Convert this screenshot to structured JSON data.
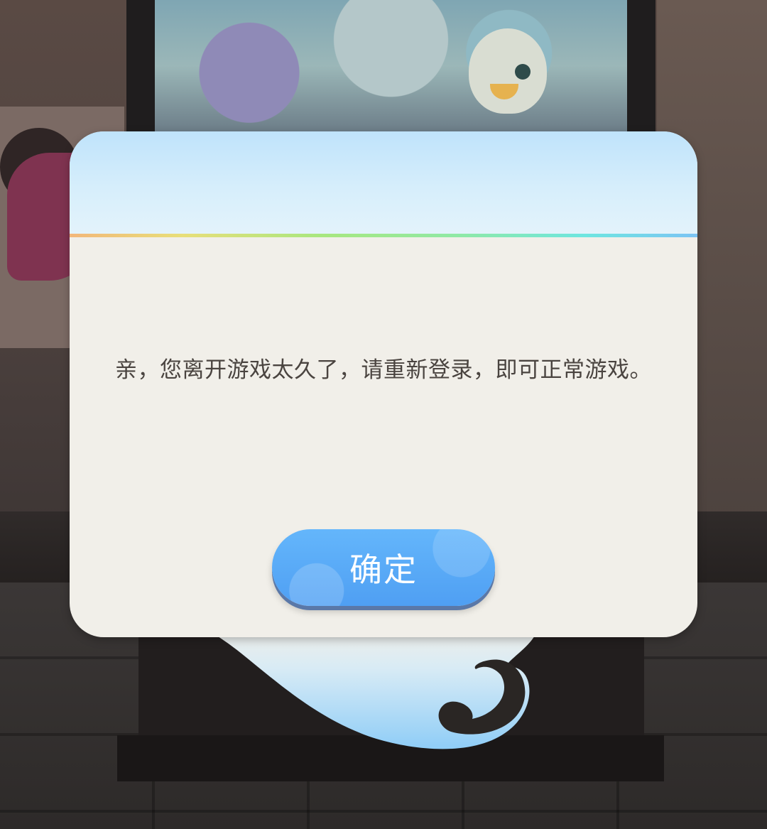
{
  "dialog": {
    "message": "亲，您离开游戏太久了，请重新登录，即可正常游戏。",
    "confirm_label": "确定"
  },
  "colors": {
    "header_blue": "#bfe3fb",
    "body_bg": "#f1efe9",
    "button_blue": "#5aabf7",
    "text": "#4a4440"
  },
  "icons": {
    "tail_decoration": "swirl-tail"
  }
}
